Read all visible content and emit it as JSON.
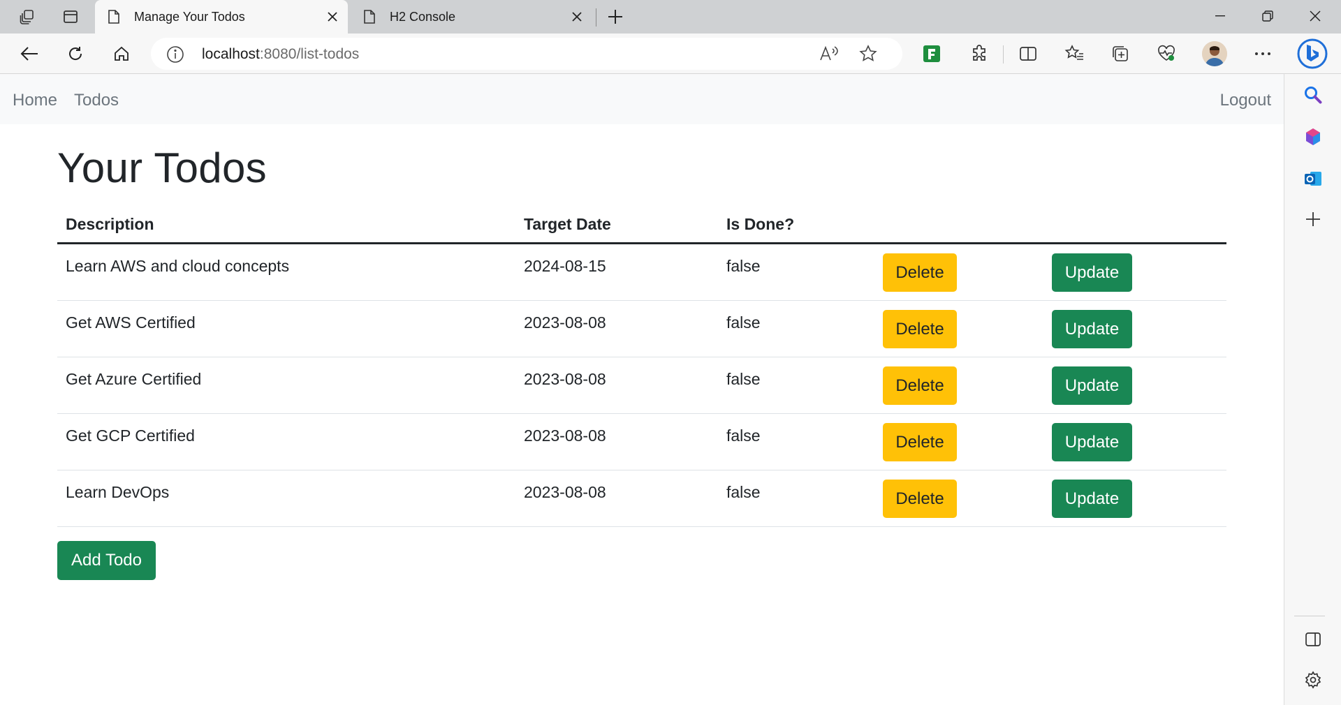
{
  "browser": {
    "tabs": [
      {
        "title": "Manage Your Todos",
        "active": true
      },
      {
        "title": "H2 Console",
        "active": false
      }
    ],
    "address": {
      "host": "localhost",
      "path": ":8080/list-todos"
    },
    "icons": {
      "workspaces": "workspaces-icon",
      "tab_actions": "vertical-tabs-icon",
      "new_tab": "plus-icon",
      "back": "back-arrow-icon",
      "refresh": "refresh-icon",
      "home": "home-icon",
      "site_info": "info-icon",
      "read_aloud": "read-aloud-icon",
      "favorite": "star-icon",
      "extension_green": "extension-icon",
      "extensions": "puzzle-icon",
      "split_screen": "split-screen-icon",
      "favorites": "favorites-icon",
      "collections": "collections-icon",
      "performance": "heartbeat-icon",
      "menu": "more-icon",
      "copilot": "bing-icon"
    },
    "sidebar_icons": [
      "search-icon",
      "office-icon",
      "outlook-icon",
      "add-icon",
      "sidebar-toggle-icon",
      "settings-icon"
    ]
  },
  "navbar": {
    "home": "Home",
    "todos": "Todos",
    "logout": "Logout"
  },
  "page": {
    "title": "Your Todos",
    "add_button": "Add Todo"
  },
  "table": {
    "headers": [
      "Description",
      "Target Date",
      "Is Done?"
    ],
    "rows": [
      {
        "description": "Learn AWS and cloud concepts",
        "target_date": "2024-08-15",
        "done": "false",
        "delete": "Delete",
        "update": "Update"
      },
      {
        "description": "Get AWS Certified",
        "target_date": "2023-08-08",
        "done": "false",
        "delete": "Delete",
        "update": "Update"
      },
      {
        "description": "Get Azure Certified",
        "target_date": "2023-08-08",
        "done": "false",
        "delete": "Delete",
        "update": "Update"
      },
      {
        "description": "Get GCP Certified",
        "target_date": "2023-08-08",
        "done": "false",
        "delete": "Delete",
        "update": "Update"
      },
      {
        "description": "Learn DevOps",
        "target_date": "2023-08-08",
        "done": "false",
        "delete": "Delete",
        "update": "Update"
      }
    ]
  },
  "colors": {
    "delete_button": "#ffc107",
    "update_button": "#198754",
    "navbar_bg": "#f8f9fa",
    "tab_strip": "#cfd1d3"
  }
}
